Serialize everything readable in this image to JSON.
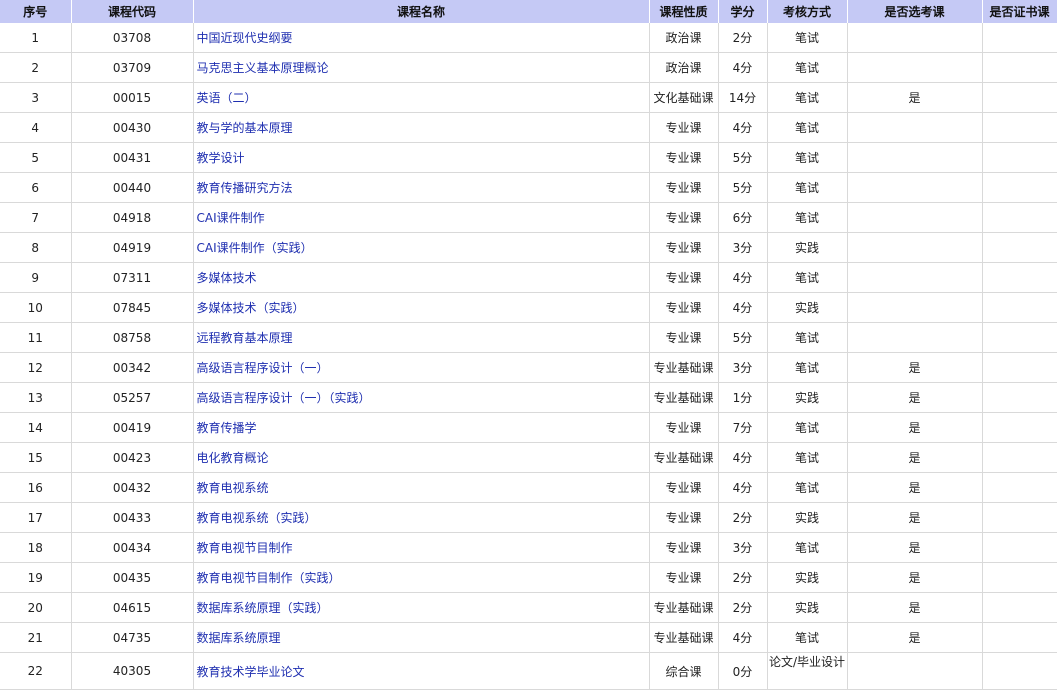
{
  "headers": {
    "idx": "序号",
    "code": "课程代码",
    "name": "课程名称",
    "type": "课程性质",
    "credit": "学分",
    "exam": "考核方式",
    "elective": "是否选考课",
    "cert": "是否证书课"
  },
  "rows": [
    {
      "idx": "1",
      "code": "03708",
      "name": "中国近现代史纲要",
      "type": "政治课",
      "credit": "2分",
      "exam": "笔试",
      "elective": "",
      "cert": ""
    },
    {
      "idx": "2",
      "code": "03709",
      "name": "马克思主义基本原理概论",
      "type": "政治课",
      "credit": "4分",
      "exam": "笔试",
      "elective": "",
      "cert": ""
    },
    {
      "idx": "3",
      "code": "00015",
      "name": "英语（二）",
      "type": "文化基础课",
      "credit": "14分",
      "exam": "笔试",
      "elective": "是",
      "cert": ""
    },
    {
      "idx": "4",
      "code": "00430",
      "name": "教与学的基本原理",
      "type": "专业课",
      "credit": "4分",
      "exam": "笔试",
      "elective": "",
      "cert": ""
    },
    {
      "idx": "5",
      "code": "00431",
      "name": "教学设计",
      "type": "专业课",
      "credit": "5分",
      "exam": "笔试",
      "elective": "",
      "cert": ""
    },
    {
      "idx": "6",
      "code": "00440",
      "name": "教育传播研究方法",
      "type": "专业课",
      "credit": "5分",
      "exam": "笔试",
      "elective": "",
      "cert": ""
    },
    {
      "idx": "7",
      "code": "04918",
      "name": "CAI课件制作",
      "type": "专业课",
      "credit": "6分",
      "exam": "笔试",
      "elective": "",
      "cert": ""
    },
    {
      "idx": "8",
      "code": "04919",
      "name": "CAI课件制作（实践）",
      "type": "专业课",
      "credit": "3分",
      "exam": "实践",
      "elective": "",
      "cert": ""
    },
    {
      "idx": "9",
      "code": "07311",
      "name": "多媒体技术",
      "type": "专业课",
      "credit": "4分",
      "exam": "笔试",
      "elective": "",
      "cert": ""
    },
    {
      "idx": "10",
      "code": "07845",
      "name": "多媒体技术（实践）",
      "type": "专业课",
      "credit": "4分",
      "exam": "实践",
      "elective": "",
      "cert": ""
    },
    {
      "idx": "11",
      "code": "08758",
      "name": "远程教育基本原理",
      "type": "专业课",
      "credit": "5分",
      "exam": "笔试",
      "elective": "",
      "cert": ""
    },
    {
      "idx": "12",
      "code": "00342",
      "name": "高级语言程序设计（一）",
      "type": "专业基础课",
      "credit": "3分",
      "exam": "笔试",
      "elective": "是",
      "cert": ""
    },
    {
      "idx": "13",
      "code": "05257",
      "name": "高级语言程序设计（一）（实践）",
      "type": "专业基础课",
      "credit": "1分",
      "exam": "实践",
      "elective": "是",
      "cert": ""
    },
    {
      "idx": "14",
      "code": "00419",
      "name": "教育传播学",
      "type": "专业课",
      "credit": "7分",
      "exam": "笔试",
      "elective": "是",
      "cert": ""
    },
    {
      "idx": "15",
      "code": "00423",
      "name": "电化教育概论",
      "type": "专业基础课",
      "credit": "4分",
      "exam": "笔试",
      "elective": "是",
      "cert": ""
    },
    {
      "idx": "16",
      "code": "00432",
      "name": "教育电视系统",
      "type": "专业课",
      "credit": "4分",
      "exam": "笔试",
      "elective": "是",
      "cert": ""
    },
    {
      "idx": "17",
      "code": "00433",
      "name": "教育电视系统（实践）",
      "type": "专业课",
      "credit": "2分",
      "exam": "实践",
      "elective": "是",
      "cert": ""
    },
    {
      "idx": "18",
      "code": "00434",
      "name": "教育电视节目制作",
      "type": "专业课",
      "credit": "3分",
      "exam": "笔试",
      "elective": "是",
      "cert": ""
    },
    {
      "idx": "19",
      "code": "00435",
      "name": "教育电视节目制作（实践）",
      "type": "专业课",
      "credit": "2分",
      "exam": "实践",
      "elective": "是",
      "cert": ""
    },
    {
      "idx": "20",
      "code": "04615",
      "name": "数据库系统原理（实践）",
      "type": "专业基础课",
      "credit": "2分",
      "exam": "实践",
      "elective": "是",
      "cert": ""
    },
    {
      "idx": "21",
      "code": "04735",
      "name": "数据库系统原理",
      "type": "专业基础课",
      "credit": "4分",
      "exam": "笔试",
      "elective": "是",
      "cert": ""
    },
    {
      "idx": "22",
      "code": "40305",
      "name": "教育技术学毕业论文",
      "type": "综合课",
      "credit": "0分",
      "exam": "论文/毕业设计",
      "elective": "",
      "cert": ""
    }
  ]
}
